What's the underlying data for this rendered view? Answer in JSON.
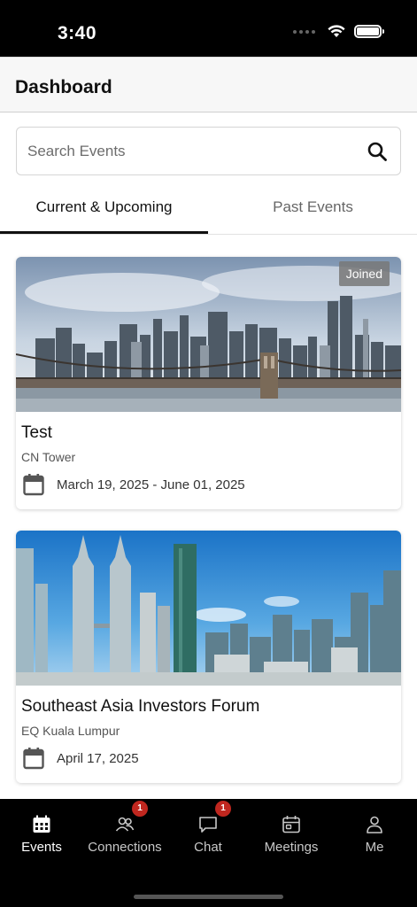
{
  "status_bar": {
    "time": "3:40"
  },
  "header": {
    "title": "Dashboard"
  },
  "search": {
    "placeholder": "Search Events",
    "value": ""
  },
  "tabs": [
    {
      "label": "Current & Upcoming",
      "active": true
    },
    {
      "label": "Past Events",
      "active": false
    }
  ],
  "events": [
    {
      "title": "Test",
      "location": "CN Tower",
      "dates": "March 19, 2025 - June 01, 2025",
      "badge": "Joined"
    },
    {
      "title": "Southeast Asia Investors Forum",
      "location": "EQ Kuala Lumpur",
      "dates": "April 17, 2025"
    }
  ],
  "tab_bar": {
    "items": [
      {
        "label": "Events",
        "icon": "calendar-grid-icon",
        "active": true
      },
      {
        "label": "Connections",
        "icon": "people-icon",
        "badge": "1"
      },
      {
        "label": "Chat",
        "icon": "chat-bubble-icon",
        "badge": "1"
      },
      {
        "label": "Meetings",
        "icon": "meeting-calendar-icon"
      },
      {
        "label": "Me",
        "icon": "person-icon"
      }
    ]
  },
  "colors": {
    "accent": "#111111",
    "badge": "#c0271f",
    "tab_bar_bg": "#000000"
  }
}
